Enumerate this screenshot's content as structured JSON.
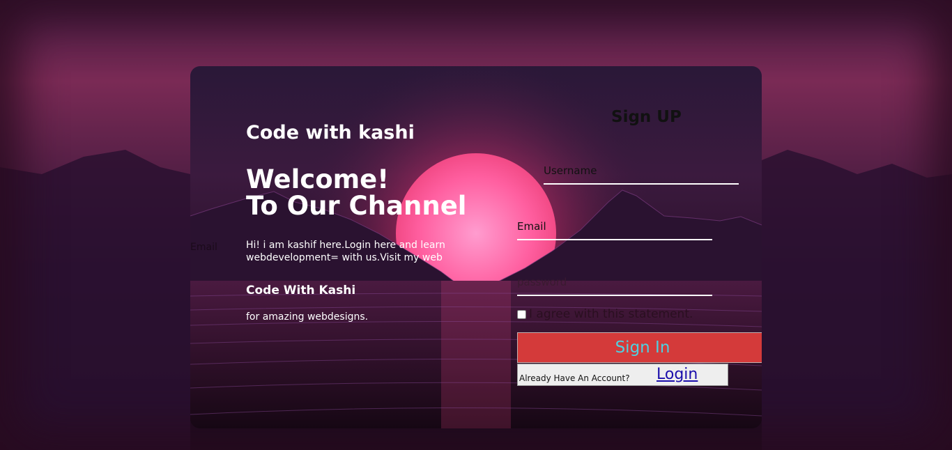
{
  "brand": "Code with kashi",
  "welcome_line1": "Welcome!",
  "welcome_line2": "To Our Channel",
  "intro_text": "Hi! i am kashif here.Login here and learn webdevelopment= with us.Visit my web",
  "sub_brand": "Code With Kashi",
  "tagline": "for amazing webdesigns.",
  "stray_label": "Email",
  "form": {
    "title": "Sign UP",
    "username_placeholder": "Username",
    "email_placeholder": "Email",
    "password_placeholder": "password",
    "agree_label": "I agree with this statement.",
    "signin_label": "Sign In",
    "account_prompt": "Already Have An Account?",
    "login_link": "Login"
  },
  "colors": {
    "signin_bg": "#d43a3a",
    "signin_text": "#4fd0e0",
    "link": "#1a0dab"
  }
}
